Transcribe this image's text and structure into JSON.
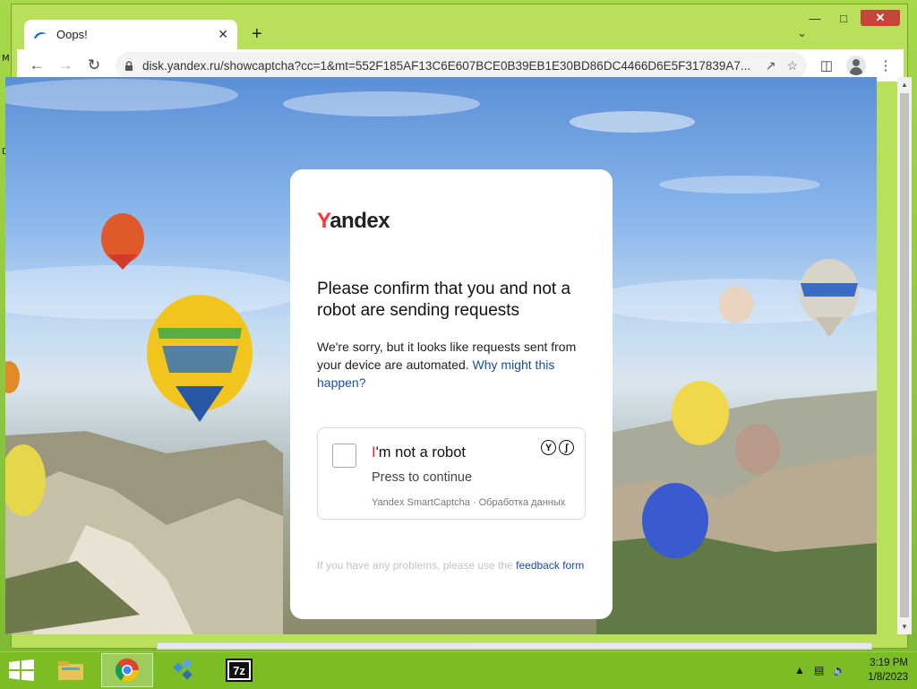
{
  "browser": {
    "tab_title": "Oops!",
    "url": "disk.yandex.ru/showcaptcha?cc=1&mt=552F185AF13C6E607BCE0B39EB1E30BD86DC4466D6E5F317839A7..."
  },
  "page": {
    "logo_first": "Y",
    "logo_rest": "andex",
    "heading": "Please confirm that you and not a robot are sending requests",
    "body": "We're sorry, but it looks like requests sent from your device are automated.",
    "why_link": "Why might this happen?",
    "captcha": {
      "title_first": "I",
      "title_rest": "'m not a robot",
      "subtitle": "Press to continue",
      "footer": "Yandex SmartCaptcha · Обработка данных"
    },
    "problems_text": "If you have any problems, please use the",
    "feedback_link": "feedback form"
  },
  "desktop": {
    "letter_top": "M",
    "letter_bottom": "D"
  },
  "taskbar": {
    "time": "3:19 PM",
    "date": "1/8/2023",
    "apps": [
      "file-explorer",
      "chrome",
      "app-cubes",
      "7zip"
    ]
  },
  "colors": {
    "accent_red": "#ff3333",
    "link_blue": "#1a4ea0",
    "taskbar": "#7cbd26"
  }
}
